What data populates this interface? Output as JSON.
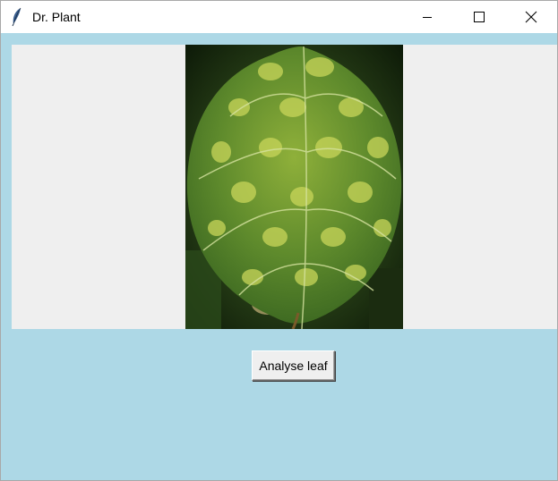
{
  "window": {
    "title": "Dr. Plant",
    "controls": {
      "minimize": "minimize-icon",
      "maximize": "maximize-icon",
      "close": "close-icon"
    }
  },
  "main": {
    "background": "#add8e6",
    "panel_background": "#efefef",
    "image": "leaf-image",
    "button_label": "Analyse leaf"
  }
}
